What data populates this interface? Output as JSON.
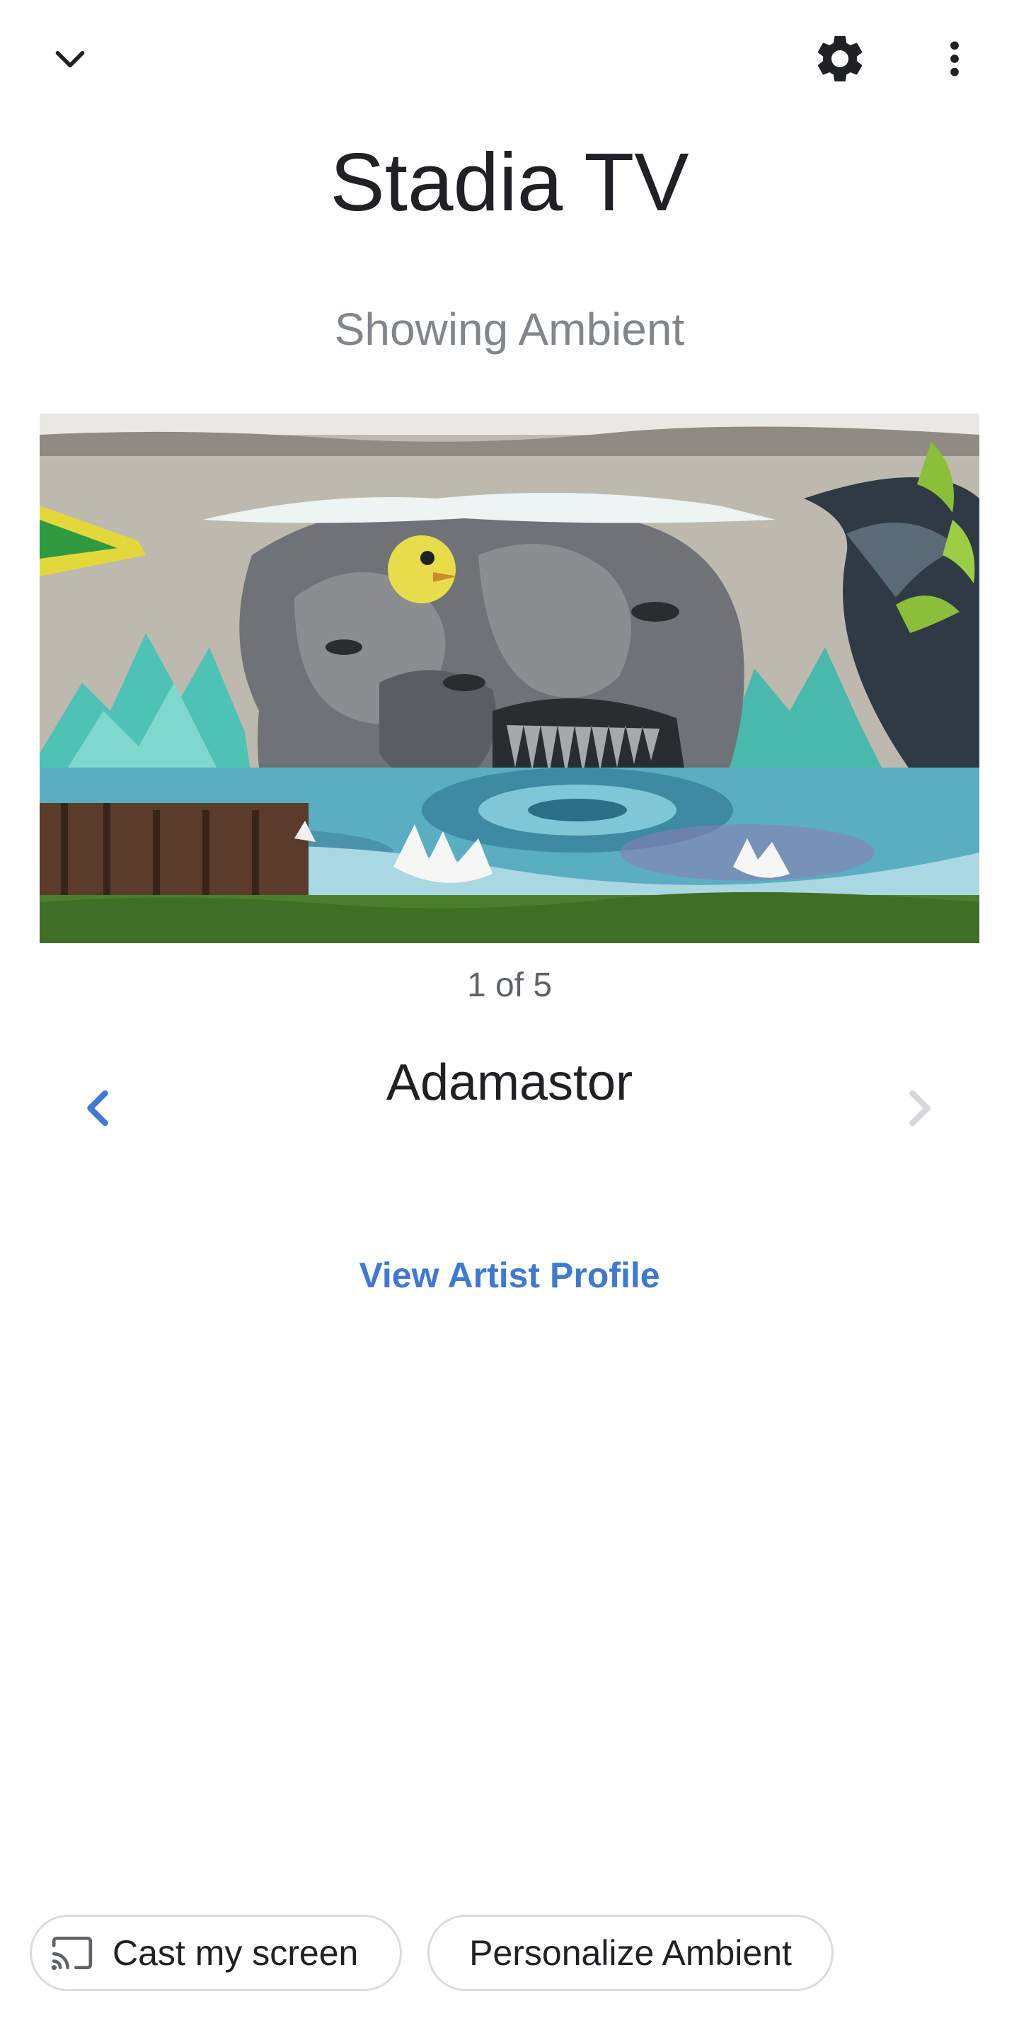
{
  "header": {
    "collapse_icon": "chevron-down-icon",
    "settings_icon": "gear-icon",
    "more_icon": "more-vertical-icon",
    "title": "Stadia TV",
    "subtitle": "Showing Ambient"
  },
  "artwork": {
    "image_description_icon": "graffiti-mural-image",
    "counter": "1 of 5",
    "title": "Adamastor",
    "prev_icon": "chevron-left-icon",
    "next_icon": "chevron-right-icon",
    "artist_link": "View Artist Profile"
  },
  "actions": {
    "cast_label": "Cast my screen",
    "cast_icon": "cast-icon",
    "personalize_label": "Personalize Ambient"
  },
  "colors": {
    "accent": "#3f79d3",
    "text_primary": "#202124",
    "text_secondary": "#80868b",
    "disabled": "#d5d7da",
    "chip_border": "#dadce0"
  }
}
